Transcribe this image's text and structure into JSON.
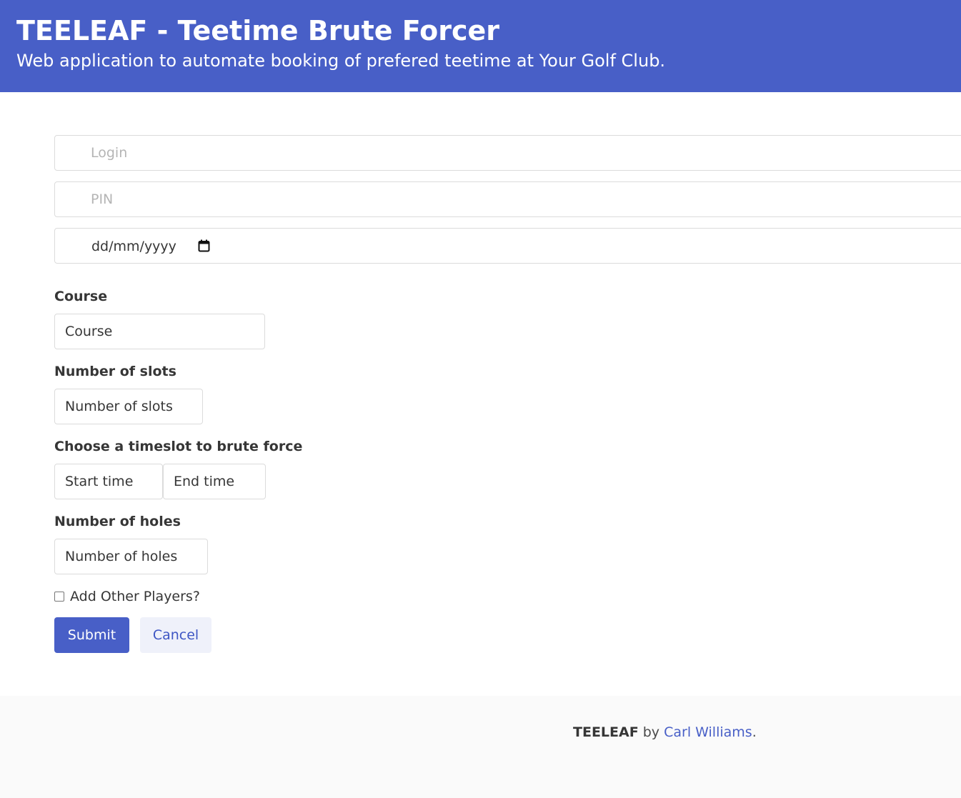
{
  "header": {
    "title": "TEELEAF - Teetime Brute Forcer",
    "subtitle": "Web application to automate booking of prefered teetime at Your Golf Club."
  },
  "form": {
    "login_placeholder": "Login",
    "pin_placeholder": "PIN",
    "date_placeholder": "dd/mm/yyyy",
    "course_label": "Course",
    "course_placeholder": "Course",
    "slots_label": "Number of slots",
    "slots_placeholder": "Number of slots",
    "timeslot_label": "Choose a timeslot to brute force",
    "start_time_placeholder": "Start time",
    "end_time_placeholder": "End time",
    "holes_label": "Number of holes",
    "holes_placeholder": "Number of holes",
    "add_players_label": "Add Other Players?",
    "add_players_checked": false,
    "submit_label": "Submit",
    "cancel_label": "Cancel"
  },
  "footer": {
    "brand": "TEELEAF",
    "by": "by",
    "author": "Carl Williams",
    "end": "."
  },
  "colors": {
    "primary": "#485fc7",
    "cancel_bg": "#eff1fa",
    "footer_bg": "#fafafa"
  },
  "icons": {
    "date_picker": "calendar-icon"
  }
}
